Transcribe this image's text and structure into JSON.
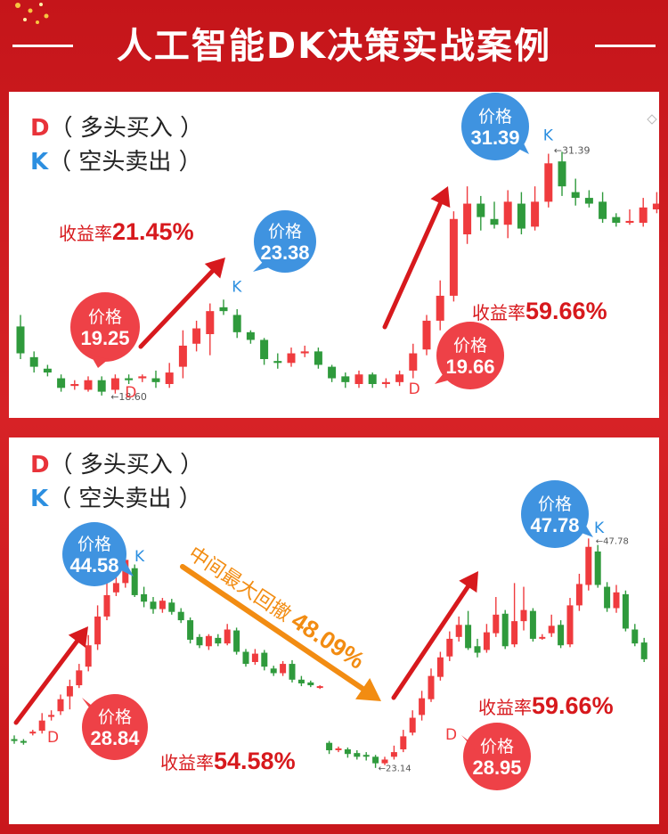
{
  "title": "人工智能DK决策实战案例",
  "colors": {
    "up": "#ef3b3e",
    "down": "#2f9a3c",
    "accent_red": "#d7191d",
    "buy_bubble": "#ee4147",
    "sell_bubble": "#3f93e0",
    "orange": "#f28c12",
    "k_blue": "#2c8fe0"
  },
  "legend": {
    "d_letter": "D",
    "d_text": "（ 多头买入 ）",
    "k_letter": "K",
    "k_text": "（ 空头卖出 ）"
  },
  "panel1": {
    "bubble_buy1": {
      "label": "价格",
      "value": "19.25"
    },
    "bubble_sell1": {
      "label": "价格",
      "value": "23.38"
    },
    "bubble_buy2": {
      "label": "价格",
      "value": "19.66"
    },
    "bubble_sell2": {
      "label": "价格",
      "value": "31.39"
    },
    "yield1": {
      "label": "收益率",
      "value": "21.45%"
    },
    "yield2": {
      "label": "收益率",
      "value": "59.66%"
    },
    "low_tag": "18.60",
    "high_tag": "31.39",
    "d_marker": "D",
    "k_marker": "K"
  },
  "panel2": {
    "bubble_buy1": {
      "label": "价格",
      "value": "28.84"
    },
    "bubble_sell1": {
      "label": "价格",
      "value": "44.58"
    },
    "bubble_buy2": {
      "label": "价格",
      "value": "28.95"
    },
    "bubble_sell2": {
      "label": "价格",
      "value": "47.78"
    },
    "yield1": {
      "label": "收益率",
      "value": "54.58%"
    },
    "yield2": {
      "label": "收益率",
      "value": "59.66%"
    },
    "drawdown": {
      "label": "中间最大回撤",
      "value": "48.09%"
    },
    "low_tag": "23.14",
    "high_tag": "47.78",
    "d_marker": "D",
    "k_marker": "K"
  },
  "chart_data": [
    {
      "type": "candlestick",
      "title": "",
      "low_annotation": 18.6,
      "high_annotation": 31.39,
      "signals": [
        {
          "type": "D",
          "price": 19.25
        },
        {
          "type": "K",
          "price": 23.38
        },
        {
          "type": "D",
          "price": 19.66
        },
        {
          "type": "K",
          "price": 31.39
        }
      ],
      "returns": [
        "21.45%",
        "59.66%"
      ],
      "candles": [
        [
          22.2,
          20.8,
          22.8,
          20.5
        ],
        [
          20.6,
          20.1,
          20.9,
          19.8
        ],
        [
          20.0,
          19.8,
          20.2,
          19.6
        ],
        [
          19.5,
          19.0,
          19.7,
          18.8
        ],
        [
          19.1,
          19.2,
          19.4,
          18.9
        ],
        [
          18.9,
          19.4,
          19.6,
          18.8
        ],
        [
          19.4,
          18.8,
          19.6,
          18.6
        ],
        [
          18.9,
          19.5,
          19.7,
          18.7
        ],
        [
          19.5,
          19.4,
          19.7,
          19.2
        ],
        [
          19.5,
          19.6,
          19.7,
          19.3
        ],
        [
          19.5,
          19.3,
          19.9,
          19.0
        ],
        [
          19.2,
          19.8,
          20.3,
          19.0
        ],
        [
          20.1,
          21.2,
          22.0,
          19.5
        ],
        [
          21.3,
          22.1,
          22.5,
          20.9
        ],
        [
          21.8,
          23.0,
          23.4,
          20.7
        ],
        [
          23.2,
          23.0,
          23.6,
          22.8
        ],
        [
          22.8,
          21.9,
          23.1,
          21.6
        ],
        [
          21.9,
          21.5,
          22.0,
          21.3
        ],
        [
          21.5,
          20.5,
          21.6,
          20.2
        ],
        [
          20.4,
          20.3,
          20.8,
          20.0
        ],
        [
          20.3,
          20.8,
          21.1,
          20.1
        ],
        [
          20.8,
          20.9,
          21.2,
          20.6
        ],
        [
          20.9,
          20.2,
          21.1,
          20.0
        ],
        [
          20.1,
          19.5,
          20.2,
          19.3
        ],
        [
          19.6,
          19.3,
          19.8,
          19.0
        ],
        [
          19.2,
          19.7,
          19.9,
          19.0
        ],
        [
          19.7,
          19.2,
          19.8,
          19.0
        ],
        [
          19.2,
          19.3,
          19.5,
          19.0
        ],
        [
          19.3,
          19.7,
          19.9,
          19.1
        ],
        [
          19.9,
          20.8,
          21.3,
          19.5
        ],
        [
          21.0,
          22.5,
          22.8,
          20.7
        ],
        [
          22.5,
          23.8,
          24.6,
          22.0
        ],
        [
          23.8,
          27.8,
          28.2,
          23.5
        ],
        [
          27.0,
          28.6,
          29.5,
          26.5
        ],
        [
          28.6,
          27.9,
          29.0,
          27.2
        ],
        [
          27.8,
          27.5,
          28.7,
          27.3
        ],
        [
          27.5,
          28.7,
          29.3,
          26.8
        ],
        [
          28.6,
          27.3,
          29.2,
          27.0
        ],
        [
          27.4,
          28.7,
          29.5,
          27.2
        ],
        [
          28.7,
          30.7,
          31.2,
          28.4
        ],
        [
          30.8,
          29.5,
          31.3,
          29.0
        ],
        [
          29.2,
          28.9,
          29.9,
          28.5
        ],
        [
          28.9,
          28.6,
          29.3,
          28.4
        ],
        [
          28.7,
          27.8,
          29.2,
          27.6
        ],
        [
          27.9,
          27.6,
          28.1,
          27.4
        ],
        [
          27.6,
          27.7,
          28.3,
          27.5
        ],
        [
          27.6,
          28.4,
          28.9,
          27.4
        ],
        [
          28.3,
          28.6,
          29.2,
          28.1
        ]
      ]
    },
    {
      "type": "candlestick",
      "title": "",
      "low_annotation": 23.14,
      "high_annotation": 47.78,
      "max_drawdown": "48.09%",
      "signals": [
        {
          "type": "D",
          "price": 28.84
        },
        {
          "type": "K",
          "price": 44.58
        },
        {
          "type": "D",
          "price": 28.95
        },
        {
          "type": "K",
          "price": 47.78
        }
      ],
      "returns": [
        "54.58%",
        "59.66%"
      ],
      "candles": [
        [
          26.2,
          26.0,
          26.6,
          25.7
        ],
        [
          26.0,
          25.9,
          26.2,
          25.6
        ],
        [
          26.9,
          27.0,
          27.2,
          26.6
        ],
        [
          27.1,
          28.2,
          29.0,
          26.8
        ],
        [
          28.6,
          28.8,
          29.3,
          28.2
        ],
        [
          29.2,
          30.5,
          31.0,
          28.8
        ],
        [
          30.8,
          31.9,
          32.6,
          29.4
        ],
        [
          32.0,
          33.6,
          34.3,
          31.7
        ],
        [
          34.0,
          36.3,
          37.4,
          33.5
        ],
        [
          36.4,
          39.4,
          40.6,
          35.8
        ],
        [
          39.4,
          41.7,
          43.5,
          39.0
        ],
        [
          42.0,
          43.0,
          43.6,
          41.6
        ],
        [
          43.0,
          45.5,
          46.3,
          42.5
        ],
        [
          44.6,
          41.7,
          45.0,
          41.5
        ],
        [
          41.8,
          41.0,
          42.6,
          40.4
        ],
        [
          41.0,
          40.2,
          41.5,
          39.7
        ],
        [
          40.2,
          41.1,
          41.4,
          39.8
        ],
        [
          40.9,
          39.9,
          41.3,
          39.6
        ],
        [
          39.9,
          39.0,
          40.3,
          38.7
        ],
        [
          39.0,
          36.9,
          39.3,
          36.5
        ],
        [
          37.2,
          36.3,
          37.5,
          36.0
        ],
        [
          36.2,
          37.3,
          37.5,
          35.8
        ],
        [
          37.1,
          36.5,
          37.5,
          36.2
        ],
        [
          36.5,
          38.0,
          38.6,
          36.3
        ],
        [
          37.9,
          35.6,
          38.2,
          35.3
        ],
        [
          35.6,
          34.3,
          35.9,
          34.0
        ],
        [
          34.5,
          35.4,
          35.9,
          34.2
        ],
        [
          35.5,
          34.0,
          35.8,
          33.6
        ],
        [
          33.8,
          33.3,
          34.1,
          33.0
        ],
        [
          33.3,
          34.3,
          34.6,
          33.0
        ],
        [
          34.3,
          32.6,
          34.7,
          32.3
        ],
        [
          32.6,
          32.2,
          33.0,
          31.9
        ],
        [
          32.3,
          32.0,
          32.5,
          31.8
        ],
        [
          31.8,
          31.9,
          32.0,
          31.6
        ],
        [
          25.8,
          25.0,
          26.0,
          24.6
        ],
        [
          25.1,
          25.2,
          25.4,
          24.8
        ],
        [
          25.1,
          24.6,
          25.3,
          24.2
        ],
        [
          24.7,
          24.3,
          25.0,
          24.0
        ],
        [
          24.5,
          24.4,
          24.8,
          23.9
        ],
        [
          24.3,
          23.6,
          24.5,
          23.1
        ],
        [
          23.6,
          24.0,
          24.3,
          23.4
        ],
        [
          24.3,
          24.8,
          25.5,
          24.0
        ],
        [
          25.1,
          26.5,
          27.2,
          24.8
        ],
        [
          26.9,
          28.5,
          29.3,
          26.6
        ],
        [
          28.8,
          30.6,
          31.4,
          28.2
        ],
        [
          30.5,
          33.0,
          33.8,
          30.2
        ],
        [
          32.9,
          35.0,
          35.6,
          32.5
        ],
        [
          35.1,
          37.0,
          37.8,
          34.6
        ],
        [
          37.2,
          38.5,
          39.4,
          36.7
        ],
        [
          38.5,
          36.0,
          40.0,
          35.8
        ],
        [
          36.2,
          35.5,
          37.0,
          35.0
        ],
        [
          35.8,
          37.7,
          38.6,
          35.5
        ],
        [
          37.6,
          39.6,
          41.5,
          37.2
        ],
        [
          39.7,
          36.2,
          40.1,
          35.9
        ],
        [
          36.4,
          38.9,
          43.0,
          36.1
        ],
        [
          38.9,
          40.1,
          42.6,
          37.9
        ],
        [
          40.0,
          37.0,
          40.3,
          36.7
        ],
        [
          37.1,
          37.2,
          37.5,
          36.9
        ],
        [
          37.6,
          38.4,
          39.6,
          37.2
        ],
        [
          38.5,
          36.3,
          39.0,
          36.0
        ],
        [
          36.4,
          40.6,
          41.4,
          36.1
        ],
        [
          40.6,
          42.9,
          44.0,
          40.0
        ],
        [
          42.8,
          46.9,
          47.8,
          42.2
        ],
        [
          46.4,
          42.8,
          47.1,
          42.5
        ],
        [
          42.6,
          40.3,
          43.1,
          39.9
        ],
        [
          40.3,
          42.0,
          42.8,
          39.8
        ],
        [
          41.8,
          38.1,
          42.2,
          37.8
        ],
        [
          38.0,
          36.5,
          38.6,
          36.2
        ],
        [
          36.6,
          34.8,
          37.1,
          34.5
        ]
      ]
    }
  ]
}
